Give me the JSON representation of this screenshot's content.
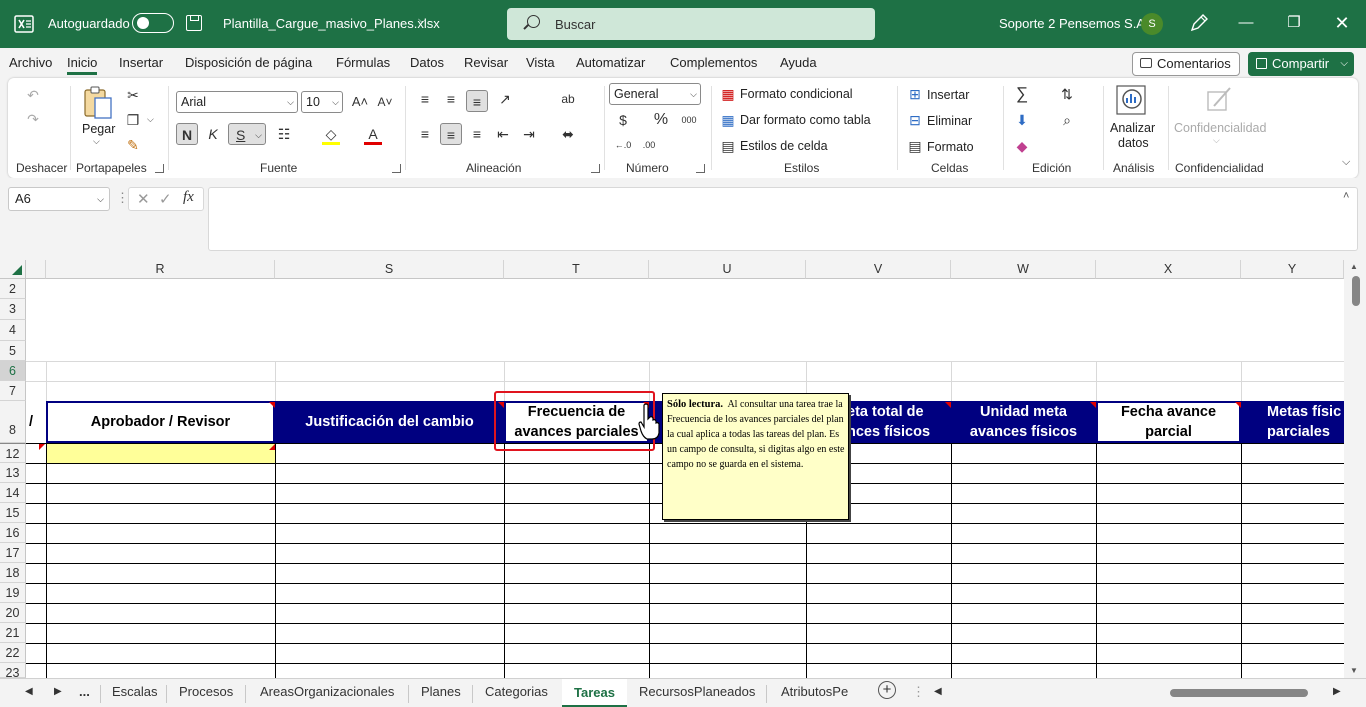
{
  "titlebar": {
    "autosave_label": "Autoguardado",
    "filename": "Plantilla_Cargue_masivo_Planes.xlsx",
    "search_placeholder": "Buscar",
    "user_name": "Soporte 2 Pensemos S.A.",
    "avatar_initial": "S"
  },
  "menu": {
    "tabs": [
      "Archivo",
      "Inicio",
      "Insertar",
      "Disposición de página",
      "Fórmulas",
      "Datos",
      "Revisar",
      "Vista",
      "Automatizar",
      "Complementos",
      "Ayuda"
    ],
    "active": "Inicio",
    "comments_label": "Comentarios",
    "share_label": "Compartir"
  },
  "ribbon": {
    "groups": {
      "undo": "Deshacer",
      "clipboard": "Portapapeles",
      "font": "Fuente",
      "alignment": "Alineación",
      "number": "Número",
      "styles": "Estilos",
      "cells": "Celdas",
      "editing": "Edición",
      "analysis": "Análisis",
      "confidentiality": "Confidencialidad"
    },
    "paste_label": "Pegar",
    "font_name": "Arial",
    "font_size": "10",
    "bold": "N",
    "italic": "K",
    "underline": "S",
    "number_format": "General",
    "conditional_format": "Formato condicional",
    "format_as_table": "Dar formato como tabla",
    "cell_styles": "Estilos de celda",
    "insert": "Insertar",
    "delete": "Eliminar",
    "format": "Formato",
    "analyze_data_line1": "Analizar",
    "analyze_data_line2": "datos",
    "confidentiality_btn": "Confidencialidad"
  },
  "formula_bar": {
    "name_box": "A6",
    "formula": ""
  },
  "columns": [
    "R",
    "S",
    "T",
    "U",
    "V",
    "W",
    "X",
    "Y"
  ],
  "rows": [
    "2",
    "3",
    "4",
    "5",
    "6",
    "7",
    "8",
    "12",
    "13",
    "14",
    "15",
    "16",
    "17",
    "18",
    "19",
    "20",
    "21",
    "22",
    "23"
  ],
  "headers": {
    "q_partial": "/",
    "r": "Aprobador / Revisor",
    "s": "Justificación del cambio",
    "t_line1": "Frecuencia de",
    "t_line2": "avances parciales",
    "v_line1": "eta total de",
    "v_line2": "nces físicos",
    "w_line1": "Unidad meta",
    "w_line2": "avances físicos",
    "x_line1": "Fecha avance",
    "x_line2": "parcial",
    "y_line1": "Metas físic",
    "y_line2": "parciales"
  },
  "tooltip": {
    "title": "Sólo lectura.",
    "body": "Al consultar una tarea trae la Frecuencia de los avances parciales del plan la cual aplica a todas las tareas del plan.  Es un campo de consulta, si digitas algo en este campo no se guarda en el sistema."
  },
  "sheets": {
    "ellipsis": "...",
    "tabs": [
      "Escalas",
      "Procesos",
      "AreasOrganizacionales",
      "Planes",
      "Categorias",
      "Tareas",
      "RecursosPlaneados",
      "AtributosPe"
    ],
    "active": "Tareas"
  },
  "colors": {
    "excel_green": "#1e7145",
    "header_navy": "#000080",
    "highlight_yellow": "#ffff99",
    "tooltip_bg": "#ffffc8",
    "annotation_red": "#e0141e"
  }
}
